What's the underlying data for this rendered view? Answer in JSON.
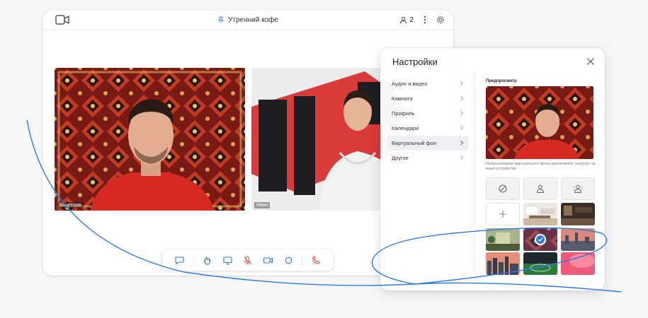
{
  "meeting": {
    "title": "Утренний кофе",
    "participant_count": "2"
  },
  "participants": [
    {
      "name": "Вячеслав"
    },
    {
      "name": "Иван"
    }
  ],
  "toolbar": {
    "icons": [
      "chat-icon",
      "hand-icon",
      "screen-share-icon",
      "mic-off-icon",
      "camera-icon",
      "record-icon",
      "end-call-icon"
    ]
  },
  "settings": {
    "title": "Настройки",
    "menu": [
      {
        "label": "Аудио и видео"
      },
      {
        "label": "Комната"
      },
      {
        "label": "Профиль"
      },
      {
        "label": "Календари"
      },
      {
        "label": "Виртуальный фон",
        "active": true
      },
      {
        "label": "Другое"
      }
    ],
    "preview_label": "Предпросмотр",
    "note": "Использование виртуального фона увеличивает нагрузку на ваше устройство",
    "backgrounds": [
      "none",
      "blur-light",
      "blur-strong",
      "add",
      "office-white",
      "office-dark",
      "green-room",
      "carpet",
      "city-sunset",
      "city-skyline",
      "stadium",
      "pink-abstract"
    ],
    "selected_background": "carpet"
  },
  "colors": {
    "accent": "#2f7be5",
    "end_call": "#e05555",
    "line": "#2f7be5"
  }
}
